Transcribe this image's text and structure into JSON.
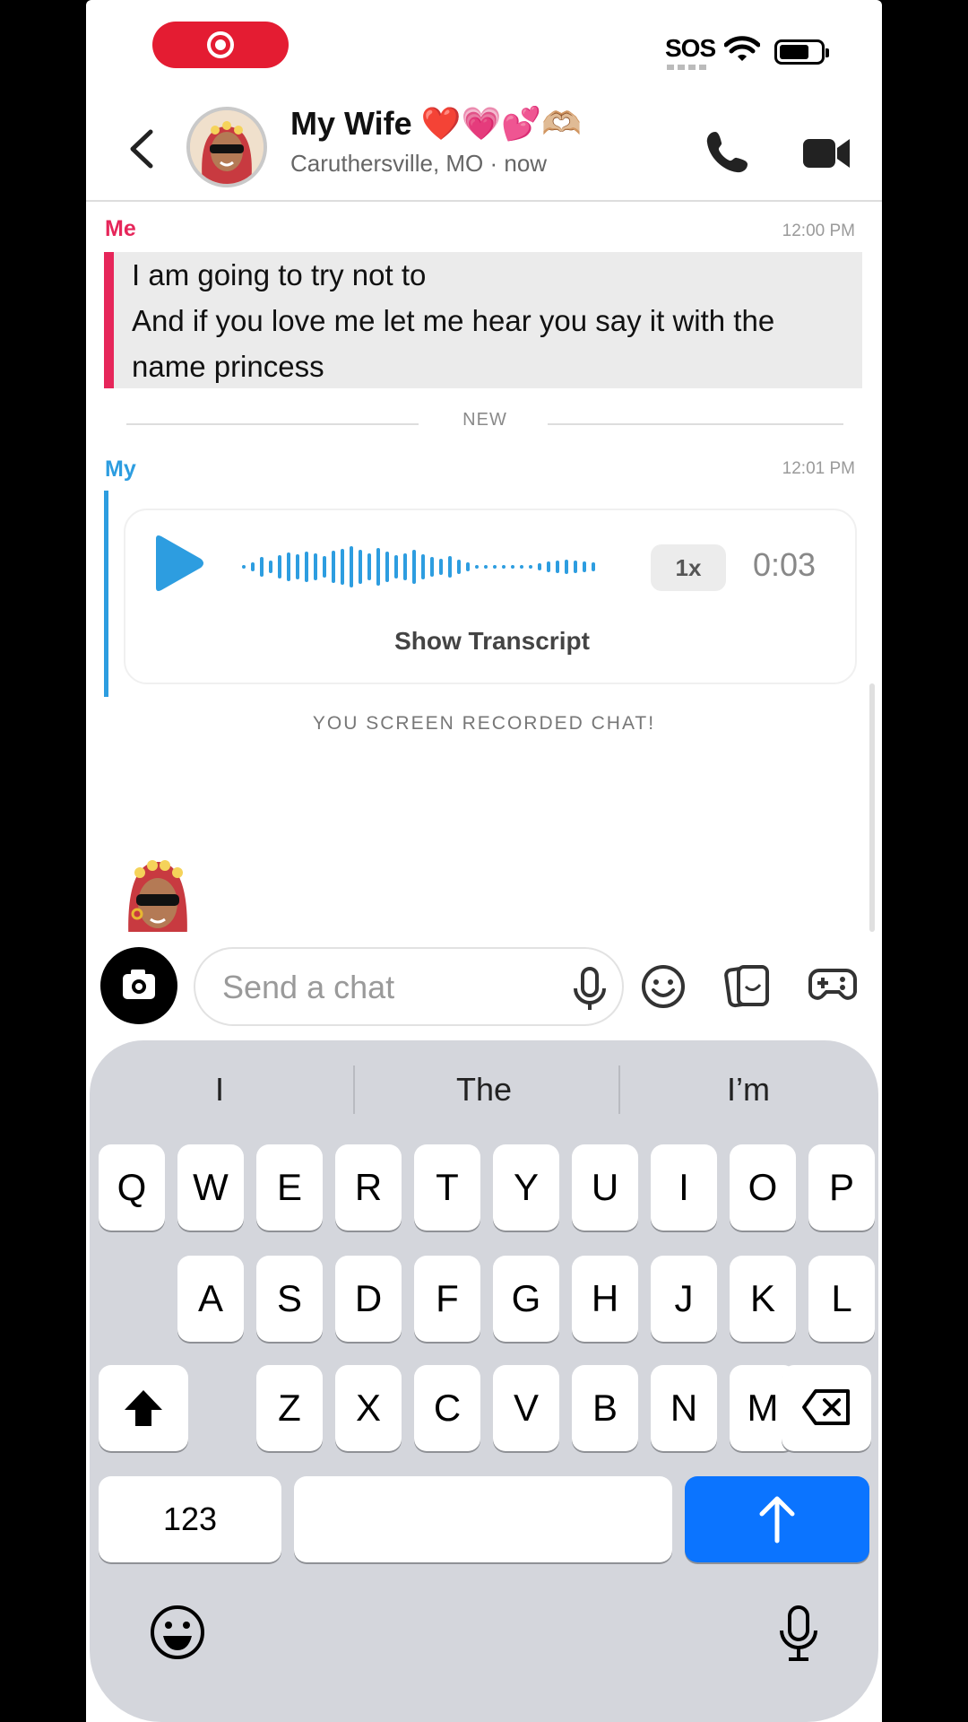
{
  "status": {
    "sos": "SOS"
  },
  "header": {
    "title": "My Wife ❤️💗💕🫶🏼",
    "subtitle": "Caruthersville, MO · now"
  },
  "messages": [
    {
      "sender": "Me",
      "time": "12:00 PM",
      "text": "I am going to try not to\nAnd if you love me let me hear you say it with the name princess",
      "color": "#e6265a"
    },
    {
      "sender": "My",
      "time": "12:01 PM",
      "type": "voice",
      "speed": "1x",
      "duration": "0:03",
      "transcript_label": "Show Transcript",
      "color": "#2d9de0"
    }
  ],
  "divider": {
    "label": "NEW"
  },
  "notice": "YOU SCREEN RECORDED CHAT!",
  "input": {
    "placeholder": "Send a chat"
  },
  "keyboard": {
    "suggestions": [
      "I",
      "The",
      "I’m"
    ],
    "row1": [
      "Q",
      "W",
      "E",
      "R",
      "T",
      "Y",
      "U",
      "I",
      "O",
      "P"
    ],
    "row2": [
      "A",
      "S",
      "D",
      "F",
      "G",
      "H",
      "J",
      "K",
      "L"
    ],
    "row3": [
      "Z",
      "X",
      "C",
      "V",
      "B",
      "N",
      "M"
    ],
    "numbers_label": "123",
    "return_color": "#0b74ff"
  }
}
